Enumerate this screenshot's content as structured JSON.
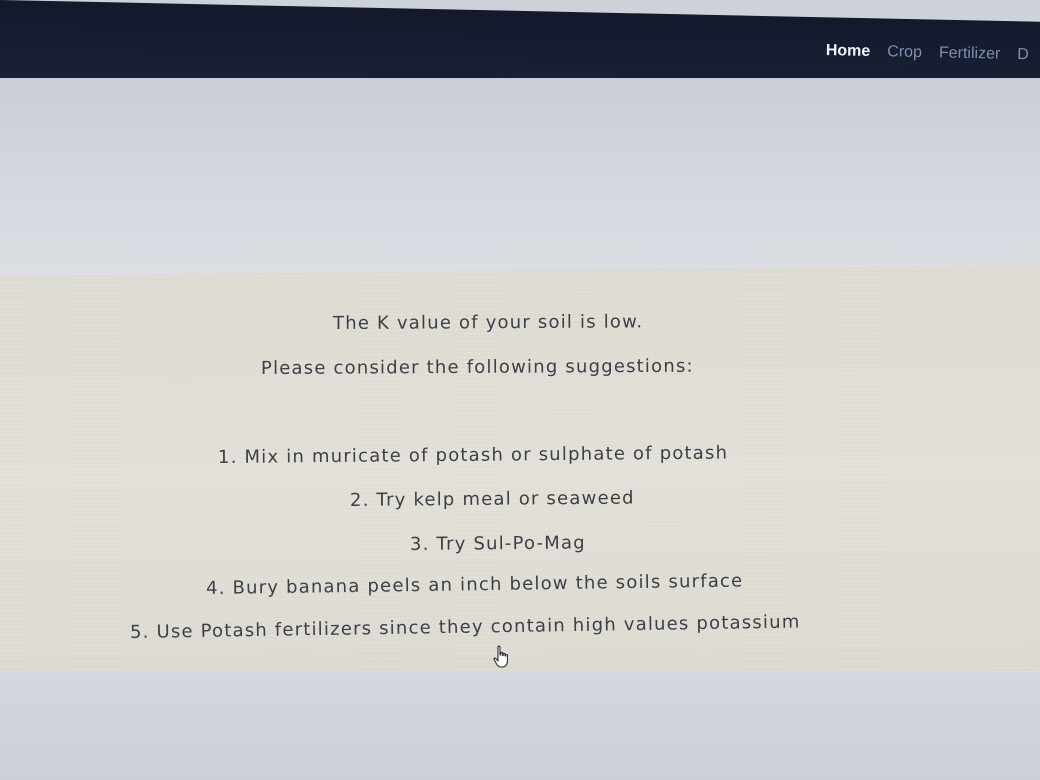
{
  "navbar": {
    "links": [
      {
        "label": "Home",
        "active": true
      },
      {
        "label": "Crop",
        "active": false
      },
      {
        "label": "Fertilizer",
        "active": false
      },
      {
        "label": "D",
        "active": false
      }
    ]
  },
  "result": {
    "heading": "The K value of your soil is low.",
    "intro": "Please consider the following suggestions:",
    "suggestions": [
      "1. Mix in muricate of potash or sulphate of potash",
      "2. Try kelp meal or seaweed",
      "3. Try Sul-Po-Mag",
      "4. Bury banana peels an inch below the soils surface",
      "5. Use Potash fertilizers since they contain high values potassium"
    ]
  },
  "icons": {
    "cursor": "hand-pointer-icon"
  },
  "colors": {
    "navbar_bg": "#161c30",
    "nav_active": "#f1f3f8",
    "nav_inactive": "#7f8fb0",
    "panel_bg": "#e0ded5",
    "text": "#3b3f48"
  }
}
